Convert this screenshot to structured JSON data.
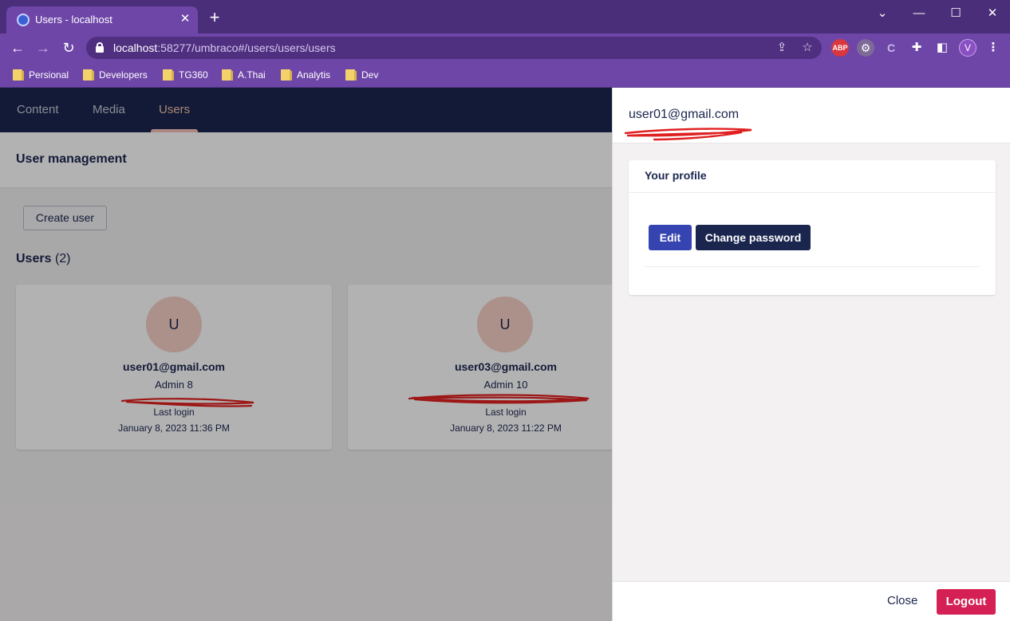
{
  "browser": {
    "tab_title": "Users - localhost",
    "tab_close": "✕",
    "new_tab": "+",
    "url_host": "localhost",
    "url_path": ":58277/umbraco#/users/users/users",
    "profile_initial": "V",
    "ext_abp": "ABP",
    "bookmarks": [
      "Persional",
      "Developers",
      "TG360",
      "A.Thai",
      "Analytis",
      "Dev"
    ],
    "icons": [
      "back-icon",
      "forward-icon",
      "reload-icon",
      "lock-icon",
      "share-icon",
      "star-icon",
      "puzzle-icon",
      "sidepanel-icon",
      "menu-icon"
    ]
  },
  "nav": {
    "items": [
      "Content",
      "Media",
      "Users"
    ],
    "active": "Users"
  },
  "page": {
    "title": "User management",
    "create_user": "Create user",
    "users_label": "Users",
    "users_count": "(2)"
  },
  "users": [
    {
      "initial": "U",
      "email": "user01@gmail.com",
      "group": "Admin 8",
      "last_login_label": "Last login",
      "last_login": "January 8, 2023 11:36 PM"
    },
    {
      "initial": "U",
      "email": "user03@gmail.com",
      "group": "Admin 10",
      "last_login_label": "Last login",
      "last_login": "January 8, 2023 11:22 PM"
    }
  ],
  "panel": {
    "title": "user01@gmail.com",
    "profile_title": "Your profile",
    "edit": "Edit",
    "change_password": "Change password",
    "close": "Close",
    "logout": "Logout"
  },
  "colors": {
    "chrome": "#6e46a8",
    "topnav": "#1b264f",
    "primary_button": "#3544b1",
    "logout": "#d42054",
    "avatar": "#f6cfc6",
    "scribble": "#e02020"
  }
}
